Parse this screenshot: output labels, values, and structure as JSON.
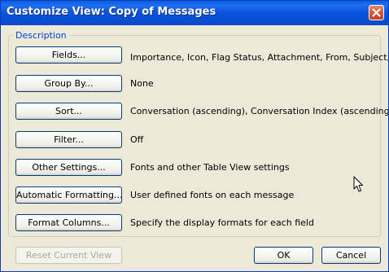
{
  "dialog": {
    "title": "Customize View: Copy of Messages",
    "group_label": "Description"
  },
  "rows": [
    {
      "button": "Fields...",
      "description": "Importance, Icon, Flag Status, Attachment, From, Subject, ..."
    },
    {
      "button": "Group By...",
      "description": "None"
    },
    {
      "button": "Sort...",
      "description": "Conversation (ascending), Conversation Index (ascending)"
    },
    {
      "button": "Filter...",
      "description": "Off"
    },
    {
      "button": "Other Settings...",
      "description": "Fonts and other Table View settings"
    },
    {
      "button": "Automatic Formatting...",
      "description": "User defined fonts on each message"
    },
    {
      "button": "Format Columns...",
      "description": "Specify the display formats for each field"
    }
  ],
  "footer": {
    "reset_label": "Reset Current View",
    "ok_label": "OK",
    "cancel_label": "Cancel"
  },
  "icons": {
    "close": "close-icon",
    "cursor": "mouse-pointer-icon"
  }
}
